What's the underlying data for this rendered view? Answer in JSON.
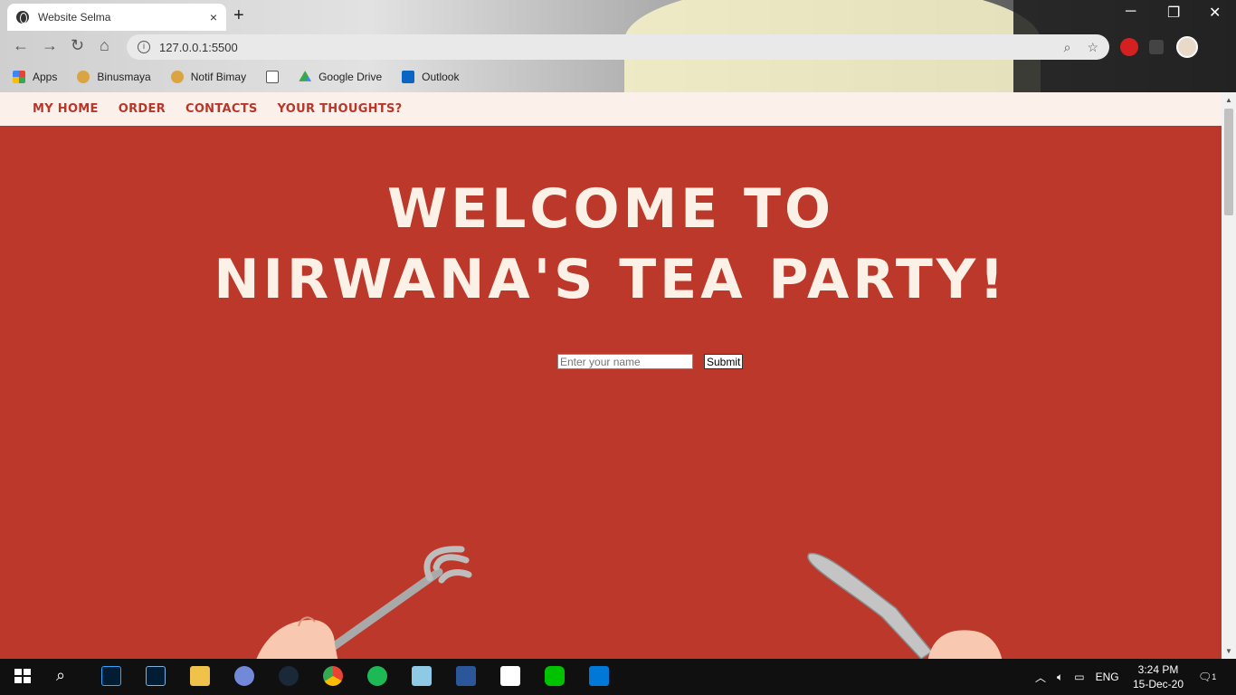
{
  "browser": {
    "tab_title": "Website Selma",
    "tab_close": "×",
    "new_tab": "+",
    "url": "127.0.0.1:5500",
    "bookmarks": [
      {
        "label": "Apps",
        "icon": "apps-grid-icon",
        "color": "#e94235"
      },
      {
        "label": "Binusmaya",
        "icon": "star-bookmark-icon",
        "color": "#d9a441"
      },
      {
        "label": "Notif Bimay",
        "icon": "star-bookmark-icon",
        "color": "#d9a441"
      },
      {
        "label": "",
        "icon": "image-bookmark-icon",
        "color": "#555555"
      },
      {
        "label": "Google Drive",
        "icon": "google-drive-icon",
        "color": "#34a853"
      },
      {
        "label": "Outlook",
        "icon": "outlook-icon",
        "color": "#0a66c2"
      }
    ]
  },
  "site": {
    "nav": [
      "MY HOME",
      "ORDER",
      "CONTACTS",
      "YOUR THOUGHTS?"
    ],
    "hero_line1": "WELCOME TO",
    "hero_line2": "NIRWANA'S TEA PARTY!",
    "name_placeholder": "Enter your name",
    "submit_label": "Submit"
  },
  "taskbar": {
    "lang": "ENG",
    "time": "3:24 PM",
    "date": "15-Dec-20",
    "notification_count": "1"
  },
  "colors": {
    "page_bg": "#bc382b",
    "nav_bg": "#fbf1ea",
    "nav_text": "#b8362a",
    "hero_text": "#fbf1e6"
  }
}
